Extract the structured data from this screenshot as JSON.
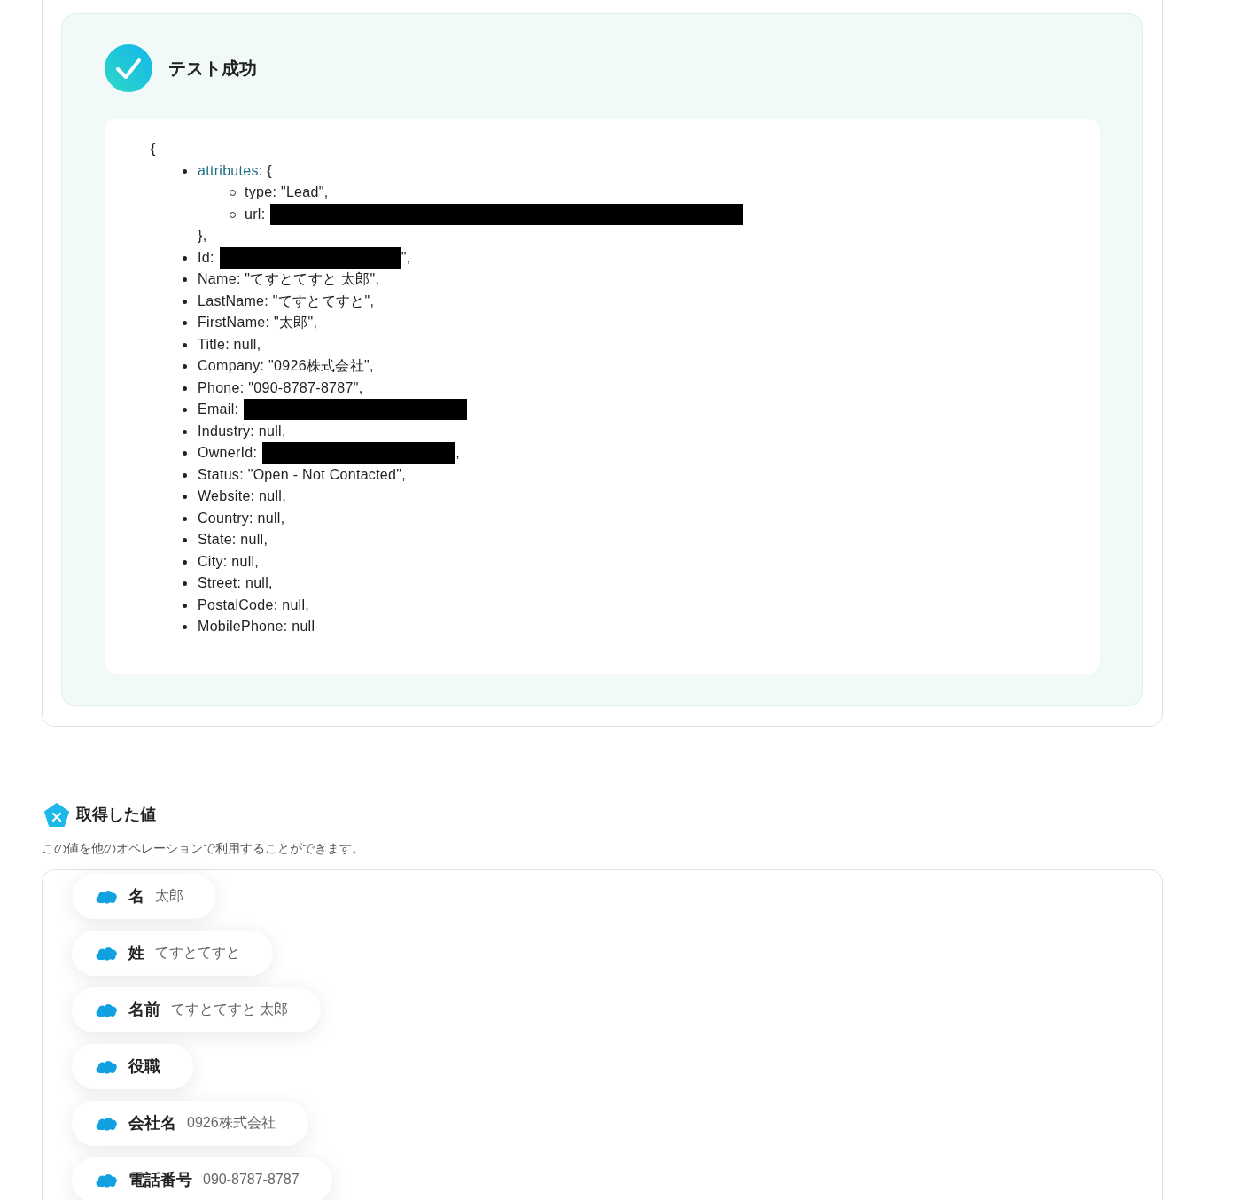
{
  "result": {
    "title": "テスト成功",
    "output": {
      "open": "{",
      "items": [
        {
          "kind": "object",
          "key": "attributes",
          "text": ": {",
          "close": "},",
          "children": [
            {
              "kind": "plain",
              "text": "type: \"Lead\","
            },
            {
              "kind": "redacted",
              "text": "url:"
            }
          ]
        },
        {
          "kind": "redacted",
          "text": "Id:",
          "after": "\","
        },
        {
          "kind": "plain",
          "text": "Name: \"てすとてすと 太郎\","
        },
        {
          "kind": "plain",
          "text": "LastName: \"てすとてすと\","
        },
        {
          "kind": "plain",
          "text": "FirstName: \"太郎\","
        },
        {
          "kind": "plain",
          "text": "Title: null,"
        },
        {
          "kind": "plain",
          "text": "Company: \"0926株式会社\","
        },
        {
          "kind": "plain",
          "text": "Phone: \"090-8787-8787\","
        },
        {
          "kind": "redacted",
          "text": "Email:"
        },
        {
          "kind": "plain",
          "text": "Industry: null,"
        },
        {
          "kind": "redacted",
          "text": "OwnerId:",
          "after": ","
        },
        {
          "kind": "plain",
          "text": "Status: \"Open - Not Contacted\","
        },
        {
          "kind": "plain",
          "text": "Website: null,"
        },
        {
          "kind": "plain",
          "text": "Country: null,"
        },
        {
          "kind": "plain",
          "text": "State: null,"
        },
        {
          "kind": "plain",
          "text": "City: null,"
        },
        {
          "kind": "plain",
          "text": "Street: null,"
        },
        {
          "kind": "plain",
          "text": "PostalCode: null,"
        },
        {
          "kind": "plain",
          "text": "MobilePhone: null"
        }
      ]
    }
  },
  "values": {
    "title": "取得した値",
    "description": "この値を他のオペレーションで利用することができます。",
    "chips": [
      {
        "label": "名",
        "value": "太郎"
      },
      {
        "label": "姓",
        "value": "てすとてすと"
      },
      {
        "label": "名前",
        "value": "てすとてすと 太郎"
      },
      {
        "label": "役職"
      },
      {
        "label": "会社名",
        "value": "0926株式会社"
      },
      {
        "label": "電話番号",
        "value": "090-8787-8787"
      }
    ]
  }
}
